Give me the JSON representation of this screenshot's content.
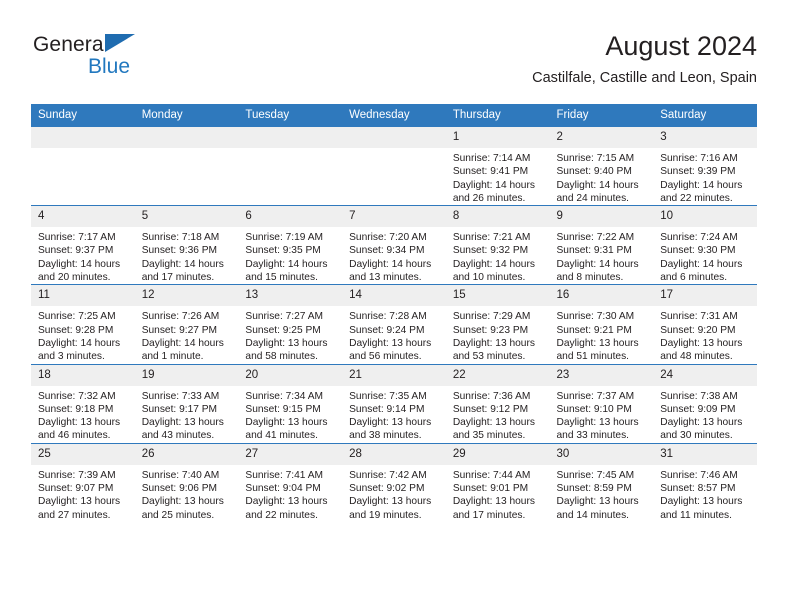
{
  "brand": {
    "name_top": "General",
    "name_bottom": "Blue",
    "triangle_color": "#1f6cb0",
    "text_color_bottom": "#2278bf"
  },
  "header": {
    "title": "August 2024",
    "subtitle": "Castilfale, Castille and Leon, Spain"
  },
  "theme": {
    "header_blue": "#2f79bd",
    "daynum_gray": "#efefef",
    "text": "#231f20"
  },
  "weekday_headers": [
    "Sunday",
    "Monday",
    "Tuesday",
    "Wednesday",
    "Thursday",
    "Friday",
    "Saturday"
  ],
  "weeks": [
    [
      {
        "day": "",
        "empty": true
      },
      {
        "day": "",
        "empty": true
      },
      {
        "day": "",
        "empty": true
      },
      {
        "day": "",
        "empty": true
      },
      {
        "day": "1",
        "sunrise": "Sunrise: 7:14 AM",
        "sunset": "Sunset: 9:41 PM",
        "daylight1": "Daylight: 14 hours",
        "daylight2": "and 26 minutes."
      },
      {
        "day": "2",
        "sunrise": "Sunrise: 7:15 AM",
        "sunset": "Sunset: 9:40 PM",
        "daylight1": "Daylight: 14 hours",
        "daylight2": "and 24 minutes."
      },
      {
        "day": "3",
        "sunrise": "Sunrise: 7:16 AM",
        "sunset": "Sunset: 9:39 PM",
        "daylight1": "Daylight: 14 hours",
        "daylight2": "and 22 minutes."
      }
    ],
    [
      {
        "day": "4",
        "sunrise": "Sunrise: 7:17 AM",
        "sunset": "Sunset: 9:37 PM",
        "daylight1": "Daylight: 14 hours",
        "daylight2": "and 20 minutes."
      },
      {
        "day": "5",
        "sunrise": "Sunrise: 7:18 AM",
        "sunset": "Sunset: 9:36 PM",
        "daylight1": "Daylight: 14 hours",
        "daylight2": "and 17 minutes."
      },
      {
        "day": "6",
        "sunrise": "Sunrise: 7:19 AM",
        "sunset": "Sunset: 9:35 PM",
        "daylight1": "Daylight: 14 hours",
        "daylight2": "and 15 minutes."
      },
      {
        "day": "7",
        "sunrise": "Sunrise: 7:20 AM",
        "sunset": "Sunset: 9:34 PM",
        "daylight1": "Daylight: 14 hours",
        "daylight2": "and 13 minutes."
      },
      {
        "day": "8",
        "sunrise": "Sunrise: 7:21 AM",
        "sunset": "Sunset: 9:32 PM",
        "daylight1": "Daylight: 14 hours",
        "daylight2": "and 10 minutes."
      },
      {
        "day": "9",
        "sunrise": "Sunrise: 7:22 AM",
        "sunset": "Sunset: 9:31 PM",
        "daylight1": "Daylight: 14 hours",
        "daylight2": "and 8 minutes."
      },
      {
        "day": "10",
        "sunrise": "Sunrise: 7:24 AM",
        "sunset": "Sunset: 9:30 PM",
        "daylight1": "Daylight: 14 hours",
        "daylight2": "and 6 minutes."
      }
    ],
    [
      {
        "day": "11",
        "sunrise": "Sunrise: 7:25 AM",
        "sunset": "Sunset: 9:28 PM",
        "daylight1": "Daylight: 14 hours",
        "daylight2": "and 3 minutes."
      },
      {
        "day": "12",
        "sunrise": "Sunrise: 7:26 AM",
        "sunset": "Sunset: 9:27 PM",
        "daylight1": "Daylight: 14 hours",
        "daylight2": "and 1 minute."
      },
      {
        "day": "13",
        "sunrise": "Sunrise: 7:27 AM",
        "sunset": "Sunset: 9:25 PM",
        "daylight1": "Daylight: 13 hours",
        "daylight2": "and 58 minutes."
      },
      {
        "day": "14",
        "sunrise": "Sunrise: 7:28 AM",
        "sunset": "Sunset: 9:24 PM",
        "daylight1": "Daylight: 13 hours",
        "daylight2": "and 56 minutes."
      },
      {
        "day": "15",
        "sunrise": "Sunrise: 7:29 AM",
        "sunset": "Sunset: 9:23 PM",
        "daylight1": "Daylight: 13 hours",
        "daylight2": "and 53 minutes."
      },
      {
        "day": "16",
        "sunrise": "Sunrise: 7:30 AM",
        "sunset": "Sunset: 9:21 PM",
        "daylight1": "Daylight: 13 hours",
        "daylight2": "and 51 minutes."
      },
      {
        "day": "17",
        "sunrise": "Sunrise: 7:31 AM",
        "sunset": "Sunset: 9:20 PM",
        "daylight1": "Daylight: 13 hours",
        "daylight2": "and 48 minutes."
      }
    ],
    [
      {
        "day": "18",
        "sunrise": "Sunrise: 7:32 AM",
        "sunset": "Sunset: 9:18 PM",
        "daylight1": "Daylight: 13 hours",
        "daylight2": "and 46 minutes."
      },
      {
        "day": "19",
        "sunrise": "Sunrise: 7:33 AM",
        "sunset": "Sunset: 9:17 PM",
        "daylight1": "Daylight: 13 hours",
        "daylight2": "and 43 minutes."
      },
      {
        "day": "20",
        "sunrise": "Sunrise: 7:34 AM",
        "sunset": "Sunset: 9:15 PM",
        "daylight1": "Daylight: 13 hours",
        "daylight2": "and 41 minutes."
      },
      {
        "day": "21",
        "sunrise": "Sunrise: 7:35 AM",
        "sunset": "Sunset: 9:14 PM",
        "daylight1": "Daylight: 13 hours",
        "daylight2": "and 38 minutes."
      },
      {
        "day": "22",
        "sunrise": "Sunrise: 7:36 AM",
        "sunset": "Sunset: 9:12 PM",
        "daylight1": "Daylight: 13 hours",
        "daylight2": "and 35 minutes."
      },
      {
        "day": "23",
        "sunrise": "Sunrise: 7:37 AM",
        "sunset": "Sunset: 9:10 PM",
        "daylight1": "Daylight: 13 hours",
        "daylight2": "and 33 minutes."
      },
      {
        "day": "24",
        "sunrise": "Sunrise: 7:38 AM",
        "sunset": "Sunset: 9:09 PM",
        "daylight1": "Daylight: 13 hours",
        "daylight2": "and 30 minutes."
      }
    ],
    [
      {
        "day": "25",
        "sunrise": "Sunrise: 7:39 AM",
        "sunset": "Sunset: 9:07 PM",
        "daylight1": "Daylight: 13 hours",
        "daylight2": "and 27 minutes."
      },
      {
        "day": "26",
        "sunrise": "Sunrise: 7:40 AM",
        "sunset": "Sunset: 9:06 PM",
        "daylight1": "Daylight: 13 hours",
        "daylight2": "and 25 minutes."
      },
      {
        "day": "27",
        "sunrise": "Sunrise: 7:41 AM",
        "sunset": "Sunset: 9:04 PM",
        "daylight1": "Daylight: 13 hours",
        "daylight2": "and 22 minutes."
      },
      {
        "day": "28",
        "sunrise": "Sunrise: 7:42 AM",
        "sunset": "Sunset: 9:02 PM",
        "daylight1": "Daylight: 13 hours",
        "daylight2": "and 19 minutes."
      },
      {
        "day": "29",
        "sunrise": "Sunrise: 7:44 AM",
        "sunset": "Sunset: 9:01 PM",
        "daylight1": "Daylight: 13 hours",
        "daylight2": "and 17 minutes."
      },
      {
        "day": "30",
        "sunrise": "Sunrise: 7:45 AM",
        "sunset": "Sunset: 8:59 PM",
        "daylight1": "Daylight: 13 hours",
        "daylight2": "and 14 minutes."
      },
      {
        "day": "31",
        "sunrise": "Sunrise: 7:46 AM",
        "sunset": "Sunset: 8:57 PM",
        "daylight1": "Daylight: 13 hours",
        "daylight2": "and 11 minutes."
      }
    ]
  ]
}
